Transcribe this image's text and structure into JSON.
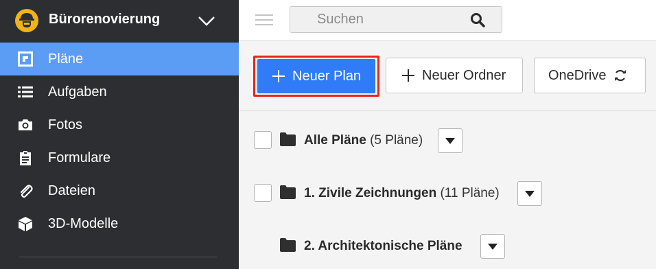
{
  "project": {
    "name": "Bürorenovierung",
    "logo_icon": "construction-worker-logo-icon",
    "dropdown_icon": "chevron-down-icon"
  },
  "sidebar": {
    "items": [
      {
        "label": "Pläne",
        "icon": "plans-icon",
        "active": true
      },
      {
        "label": "Aufgaben",
        "icon": "list-icon",
        "active": false
      },
      {
        "label": "Fotos",
        "icon": "camera-icon",
        "active": false
      },
      {
        "label": "Formulare",
        "icon": "clipboard-icon",
        "active": false
      },
      {
        "label": "Dateien",
        "icon": "paperclip-icon",
        "active": false
      },
      {
        "label": "3D-Modelle",
        "icon": "cube-icon",
        "active": false
      }
    ]
  },
  "search": {
    "placeholder": "Suchen",
    "value": ""
  },
  "toolbar": {
    "new_plan_label": "Neuer Plan",
    "new_folder_label": "Neuer Ordner",
    "onedrive_label": "OneDrive"
  },
  "folders": [
    {
      "name": "Alle Pläne",
      "count": "(5 Pläne)",
      "checkbox": true
    },
    {
      "name": "1. Zivile Zeichnungen",
      "count": "(11 Pläne)",
      "checkbox": true
    },
    {
      "name": "2. Architektonische Pläne",
      "count": "",
      "checkbox": false
    }
  ],
  "colors": {
    "sidebar_bg": "#2c2e31",
    "active_item": "#5b9cf5",
    "primary_button": "#2f7cf6",
    "highlight_border": "#e8231d"
  }
}
